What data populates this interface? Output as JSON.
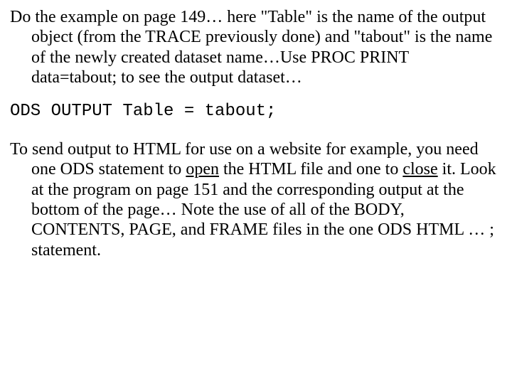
{
  "para1": {
    "t1": "Do the example on page 149… here \"Table\" is the name of the output object (from the TRACE previously done) and \"tabout\" is the name of the newly created dataset name…Use PROC PRINT data=tabout; to see the output dataset…"
  },
  "code1": "ODS OUTPUT Table = tabout;",
  "para2": {
    "t1": "To send output to HTML for use on a website for example, you need one ODS statement to ",
    "u1": "open",
    "t2": " the HTML file and one to ",
    "u2": "close",
    "t3": " it.  Look at the program on page 151 and the corresponding output at the bottom of the page… Note the use of all of the BODY, CONTENTS, PAGE, and FRAME files in the one ODS HTML … ;   statement."
  }
}
